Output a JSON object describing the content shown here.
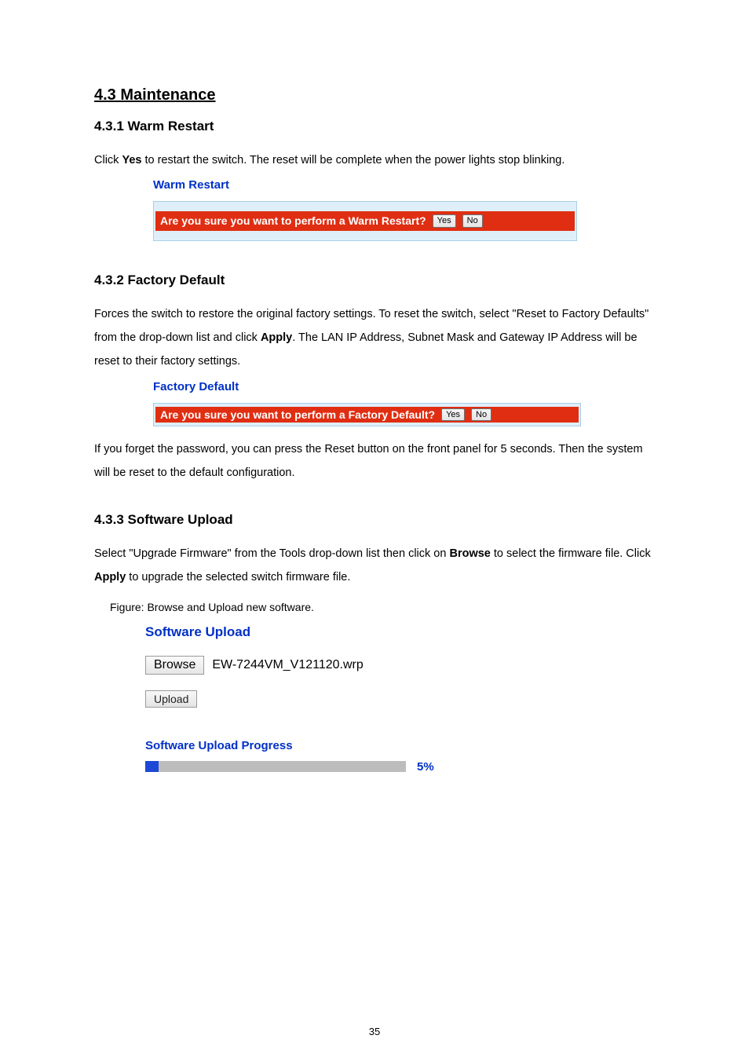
{
  "headings": {
    "h1": "4.3 Maintenance",
    "h431": "4.3.1 Warm Restart",
    "h432": "4.3.2 Factory Default",
    "h433": "4.3.3 Software Upload"
  },
  "paragraphs": {
    "p431_pre": "Click ",
    "p431_bold": "Yes",
    "p431_post": " to restart the switch. The reset will be complete when the power lights stop blinking.",
    "p432a_pre": "Forces the switch to restore the original factory settings. To reset the switch, select \"Reset to Factory Defaults\" from the drop-down list and click ",
    "p432a_bold": "Apply",
    "p432a_post": ". The LAN IP Address, Subnet Mask and Gateway IP Address will be reset to their factory settings.",
    "p432b": "If you forget the password, you can press the Reset button on the front panel for 5 seconds. Then the system will be reset to the default configuration.",
    "p433_pre": "Select \"Upgrade Firmware\" from the Tools drop-down list then click on ",
    "p433_bold1": "Browse",
    "p433_mid": " to select the firmware file. Click ",
    "p433_bold2": "Apply",
    "p433_post": " to upgrade the selected switch firmware file.",
    "figure_caption": "Figure: Browse and Upload new software."
  },
  "warm_restart": {
    "title": "Warm Restart",
    "question": "Are you sure you want to perform a Warm Restart?",
    "yes": "Yes",
    "no": "No"
  },
  "factory_default": {
    "title": "Factory Default",
    "question": "Are you sure you want to perform a Factory Default?",
    "yes": "Yes",
    "no": "No"
  },
  "software_upload": {
    "title": "Software Upload",
    "browse": "Browse",
    "filename": "EW-7244VM_V121120.wrp",
    "upload": "Upload",
    "progress_title": "Software Upload Progress",
    "progress_pct": "5%"
  },
  "page_number": "35"
}
